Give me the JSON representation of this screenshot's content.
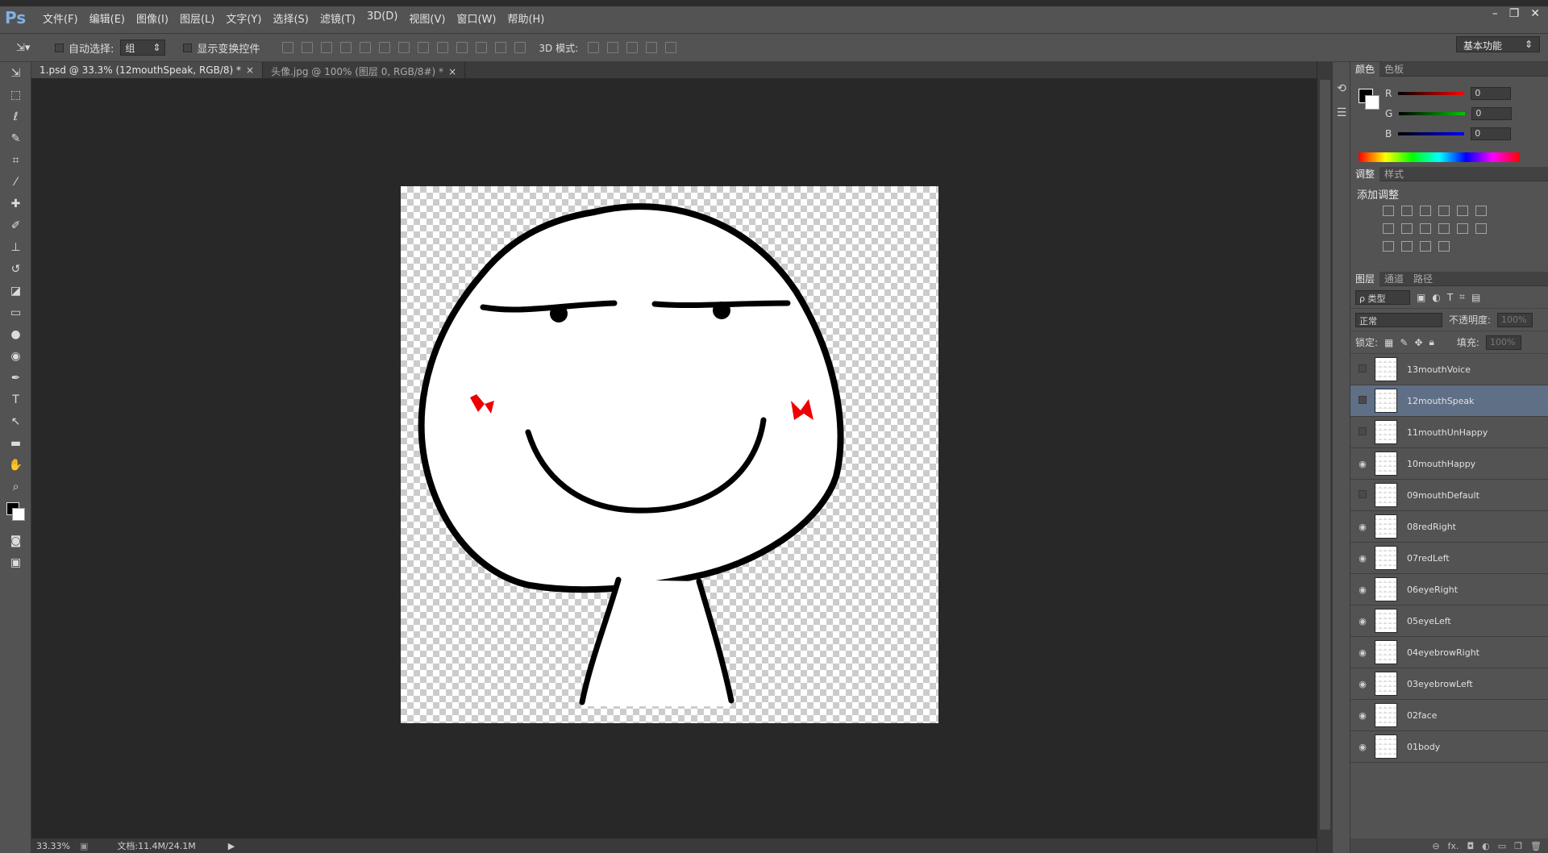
{
  "app": {
    "logo": "Ps"
  },
  "menu": [
    "文件(F)",
    "编辑(E)",
    "图像(I)",
    "图层(L)",
    "文字(Y)",
    "选择(S)",
    "滤镜(T)",
    "3D(D)",
    "视图(V)",
    "窗口(W)",
    "帮助(H)"
  ],
  "window_controls": [
    "–",
    "❐",
    "✕"
  ],
  "options": {
    "auto_select_label": "自动选择:",
    "auto_select_value": "组",
    "show_transform_label": "显示变换控件",
    "mode3d_label": "3D 模式:",
    "workspace": "基本功能"
  },
  "tabs": [
    {
      "label": "1.psd @ 33.3% (12mouthSpeak, RGB/8) *",
      "close": "×"
    },
    {
      "label": "头像.jpg @ 100% (图层 0, RGB/8#) *",
      "close": "×"
    }
  ],
  "status": {
    "zoom": "33.33%",
    "doc": "文档:11.4M/24.1M"
  },
  "color_panel": {
    "tabs": [
      "颜色",
      "色板"
    ],
    "channels": [
      {
        "label": "R",
        "value": "0",
        "color": "#ff0000"
      },
      {
        "label": "G",
        "value": "0",
        "color": "#00c800"
      },
      {
        "label": "B",
        "value": "0",
        "color": "#0000ff"
      }
    ]
  },
  "adjust_panel": {
    "tabs": [
      "调整",
      "样式"
    ],
    "title": "添加调整"
  },
  "layers_panel": {
    "tabs": [
      "图层",
      "通道",
      "路径"
    ],
    "filter": "ρ 类型",
    "blend": "正常",
    "opacity_label": "不透明度:",
    "opacity_value": "100%",
    "lock_label": "锁定:",
    "fill_label": "填充:",
    "fill_value": "100%",
    "layers": [
      {
        "name": "13mouthVoice",
        "visible": false,
        "selected": false
      },
      {
        "name": "12mouthSpeak",
        "visible": false,
        "selected": true
      },
      {
        "name": "11mouthUnHappy",
        "visible": false,
        "selected": false
      },
      {
        "name": "10mouthHappy",
        "visible": true,
        "selected": false
      },
      {
        "name": "09mouthDefault",
        "visible": false,
        "selected": false
      },
      {
        "name": "08redRight",
        "visible": true,
        "selected": false
      },
      {
        "name": "07redLeft",
        "visible": true,
        "selected": false
      },
      {
        "name": "06eyeRight",
        "visible": true,
        "selected": false
      },
      {
        "name": "05eyeLeft",
        "visible": true,
        "selected": false
      },
      {
        "name": "04eyebrowRight",
        "visible": true,
        "selected": false
      },
      {
        "name": "03eyebrowLeft",
        "visible": true,
        "selected": false
      },
      {
        "name": "02face",
        "visible": true,
        "selected": false
      },
      {
        "name": "01body",
        "visible": true,
        "selected": false
      }
    ],
    "footer": "fx."
  }
}
